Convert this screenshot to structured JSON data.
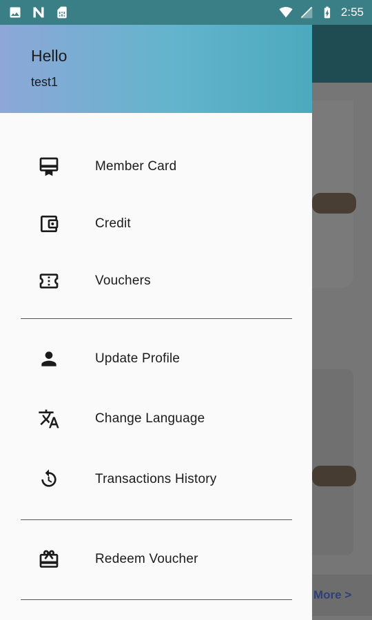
{
  "status_bar": {
    "time": "2:55",
    "left_icons": [
      "image-icon",
      "n-notification-icon",
      "sim-card-icon"
    ],
    "right_icons": [
      "wifi-icon",
      "signal-icon",
      "battery-charging-icon"
    ]
  },
  "drawer": {
    "greeting": "Hello",
    "username": "test1",
    "groups": [
      [
        {
          "icon": "member-card-icon",
          "label": "Member Card"
        },
        {
          "icon": "wallet-icon",
          "label": "Credit"
        },
        {
          "icon": "ticket-icon",
          "label": "Vouchers"
        }
      ],
      [
        {
          "icon": "person-icon",
          "label": "Update Profile"
        },
        {
          "icon": "translate-icon",
          "label": "Change Language"
        },
        {
          "icon": "history-icon",
          "label": "Transactions History"
        }
      ],
      [
        {
          "icon": "redeem-icon",
          "label": "Redeem Voucher"
        }
      ]
    ]
  },
  "background": {
    "more_link": "More >"
  }
}
